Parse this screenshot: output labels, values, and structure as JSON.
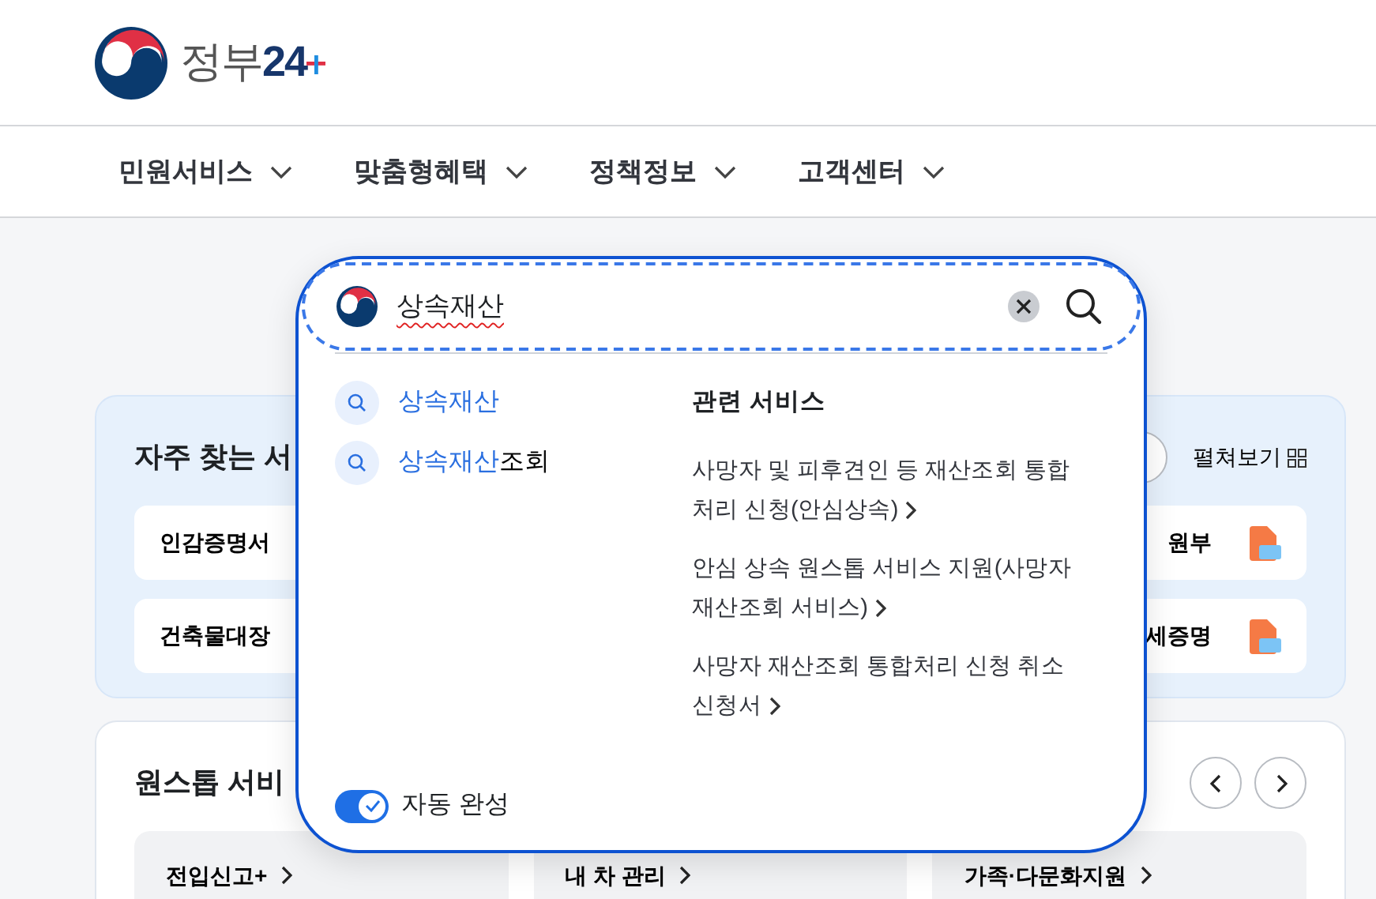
{
  "header": {
    "logo_word": "정부",
    "logo_number": "24"
  },
  "nav": [
    {
      "label": "민원서비스"
    },
    {
      "label": "맞춤형혜택"
    },
    {
      "label": "정책정보"
    },
    {
      "label": "고객센터"
    }
  ],
  "frequent": {
    "title": "자주 찾는 서",
    "expand_label": "펼쳐보기",
    "left_items": [
      {
        "label": "인감증명서"
      },
      {
        "label": "건축물대장"
      }
    ],
    "right_items": [
      {
        "label": "원부"
      },
      {
        "label": "세증명"
      }
    ]
  },
  "onestop": {
    "title": "원스톱 서비",
    "cards": [
      {
        "label": "전입신고+"
      },
      {
        "label": "내 차 관리"
      },
      {
        "label": "가족·다문화지원"
      }
    ]
  },
  "search": {
    "value": "상속재산",
    "suggestions": [
      {
        "match": "상속재산"
      },
      {
        "match": "상속재산",
        "rest": "조회"
      }
    ],
    "related_title": "관련 서비스",
    "related": [
      {
        "label": "사망자 및 피후견인 등 재산조회 통합처리 신청(안심상속)"
      },
      {
        "label": "안심 상속 원스톱 서비스 지원(사망자 재산조회 서비스)"
      },
      {
        "label": "사망자 재산조회 통합처리 신청 취소 신청서"
      }
    ],
    "autocomplete": {
      "label": "자동 완성",
      "on": true
    }
  }
}
